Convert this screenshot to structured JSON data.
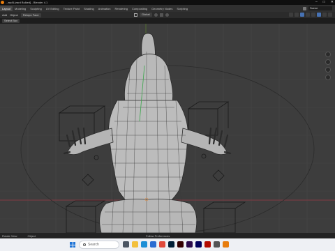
{
  "window": {
    "title": "...asd\\Lizard Bulked] - Blender 4.1",
    "controls": [
      "–",
      "□",
      "✕"
    ]
  },
  "menubar": {
    "workspace_tabs": [
      "Layout",
      "Modeling",
      "Sculpting",
      "UV Editing",
      "Texture Paint",
      "Shading",
      "Animation",
      "Rendering",
      "Compositing",
      "Geometry Nodes",
      "Scripting"
    ],
    "scene_label": "Scene"
  },
  "header": {
    "add": "Add",
    "object": "Object",
    "mode": "Retopo Face",
    "orientation": "Global"
  },
  "toolheader": {
    "select_box": "Select Box"
  },
  "statusbar": {
    "left": "Rotate View",
    "mid": "Object",
    "center": "Follow Preferences"
  },
  "taskbar": {
    "search_placeholder": "Search"
  },
  "colors": {
    "viewport_bg": "#3d3d3d",
    "mesh_fill": "#b8b8b8",
    "wire": "#2f2f2f",
    "accent": "#4772b3"
  }
}
